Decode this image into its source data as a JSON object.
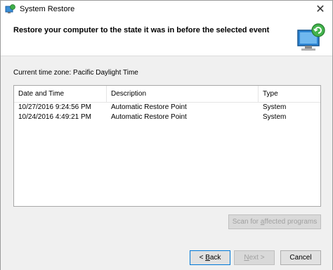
{
  "window": {
    "title": "System Restore"
  },
  "header": {
    "title": "Restore your computer to the state it was in before the selected event"
  },
  "timezone": "Current time zone: Pacific Daylight Time",
  "table": {
    "columns": [
      "Date and Time",
      "Description",
      "Type"
    ],
    "rows": [
      {
        "date": "10/27/2016 9:24:56 PM",
        "description": "Automatic Restore Point",
        "type": "System"
      },
      {
        "date": "10/24/2016 4:49:21 PM",
        "description": "Automatic Restore Point",
        "type": "System"
      }
    ]
  },
  "buttons": {
    "scan": {
      "pre": "Scan for ",
      "ul": "a",
      "post": "ffected programs"
    },
    "back": {
      "pre": "< ",
      "ul": "B",
      "post": "ack"
    },
    "next": {
      "ul": "N",
      "post": "ext >"
    },
    "cancel": "Cancel"
  },
  "colors": {
    "accent": "#0078d7",
    "content_bg": "#f0f0f0"
  }
}
